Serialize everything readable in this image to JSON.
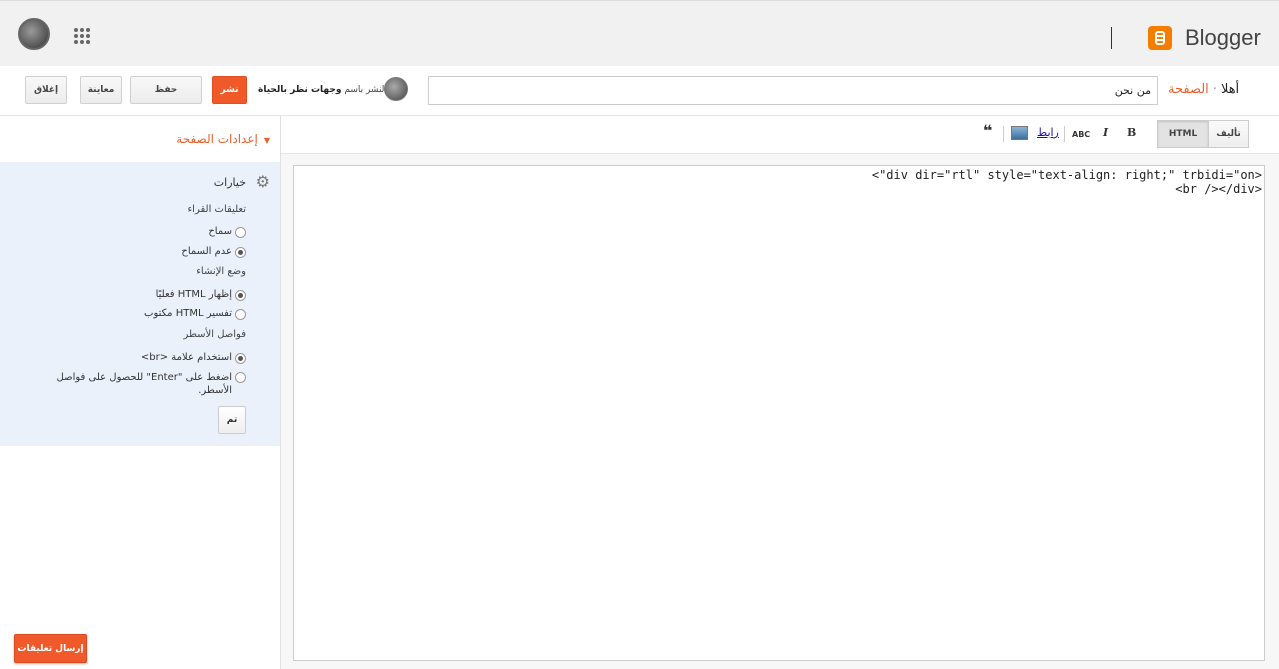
{
  "topbar": {
    "app_name": "Blogger",
    "user_avatar": "user-avatar",
    "apps_icon": "apps-grid-icon"
  },
  "actionbar": {
    "close_label": "إغلاق",
    "preview_label": "معاينة",
    "save_label": "حفظ",
    "publish_label": "نشر",
    "publish_as_prefix": "النشر باسم",
    "publish_as_name": "وجهات نظر بالحياة",
    "title_value": "من نحن",
    "breadcrumb_page": "الصفحة",
    "breadcrumb_sep": "·",
    "breadcrumb_name": "أهلا"
  },
  "sidebar": {
    "settings_heading": "إعدادات الصفحة",
    "options_title": "خيارات",
    "comments_label": "تعليقات القراء",
    "comments_options": [
      "سماح",
      "عدم السماح"
    ],
    "comments_selected": 1,
    "compose_label": "وضع الإنشاء",
    "compose_options": [
      "إظهار HTML فعليًا",
      "تفسير HTML مكتوب"
    ],
    "compose_selected": 0,
    "linebreaks_label": "فواصل الأسطر",
    "linebreaks_options": [
      "استخدام علامة <br>",
      "اضغط على \"Enter\" للحصول على فواصل الأسطر."
    ],
    "linebreaks_selected": 0,
    "done_label": "تم",
    "feedback_label": "إرسال تعليقات"
  },
  "editor": {
    "mode_html": "HTML",
    "mode_compose": "تأليف",
    "link_label": "رابط",
    "spell_label": "ABC",
    "code_line1": "<\"div dir=\"rtl\" style=\"text-align: right;\" trbidi=\"on>",
    "code_line2": "<br /></div>"
  },
  "colors": {
    "accent": "#f05a2b",
    "link_orange": "#e8602c",
    "options_bg": "#eaf1fb",
    "topbar_bg": "#f1f1f1"
  }
}
